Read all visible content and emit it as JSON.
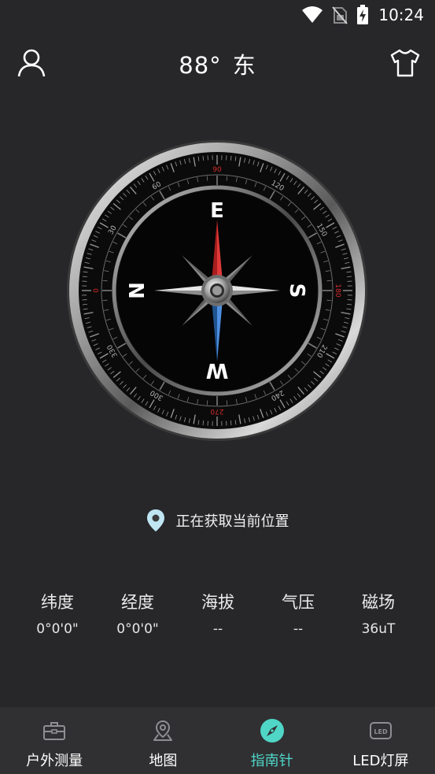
{
  "status_bar": {
    "time": "10:24",
    "icons": [
      "wifi-icon",
      "no-sim-icon",
      "battery-charging-icon"
    ]
  },
  "header": {
    "left_icon": "user-icon",
    "heading_degrees": "88°",
    "heading_direction": "东",
    "right_icon": "shirt-icon"
  },
  "compass": {
    "heading_deg": 88,
    "cardinals": {
      "top": "E",
      "right": "S",
      "bottom": "W",
      "left": "N"
    },
    "ring_labels": [
      "0",
      "30",
      "60",
      "90",
      "120",
      "150",
      "180",
      "210",
      "240",
      "270",
      "300",
      "330"
    ],
    "highlight_labels": [
      "0",
      "90",
      "180",
      "270"
    ],
    "colors": {
      "highlight": "#d42a2a",
      "needle_north": "#d62e2e",
      "needle_south": "#3f7fd1"
    }
  },
  "location": {
    "icon": "location-pin-icon",
    "text": "正在获取当前位置"
  },
  "stats": [
    {
      "label": "纬度",
      "value": "0°0'0\""
    },
    {
      "label": "经度",
      "value": "0°0'0\""
    },
    {
      "label": "海拔",
      "value": "--"
    },
    {
      "label": "气压",
      "value": "--"
    },
    {
      "label": "磁场",
      "value": "36uT"
    }
  ],
  "nav": [
    {
      "label": "户外测量",
      "icon": "toolbox-icon",
      "active": false
    },
    {
      "label": "地图",
      "icon": "map-pin-icon",
      "active": false
    },
    {
      "label": "指南针",
      "icon": "compass-icon",
      "active": true
    },
    {
      "label": "LED灯屏",
      "icon": "led-icon",
      "active": false
    }
  ],
  "accent_color": "#4fd6c6"
}
